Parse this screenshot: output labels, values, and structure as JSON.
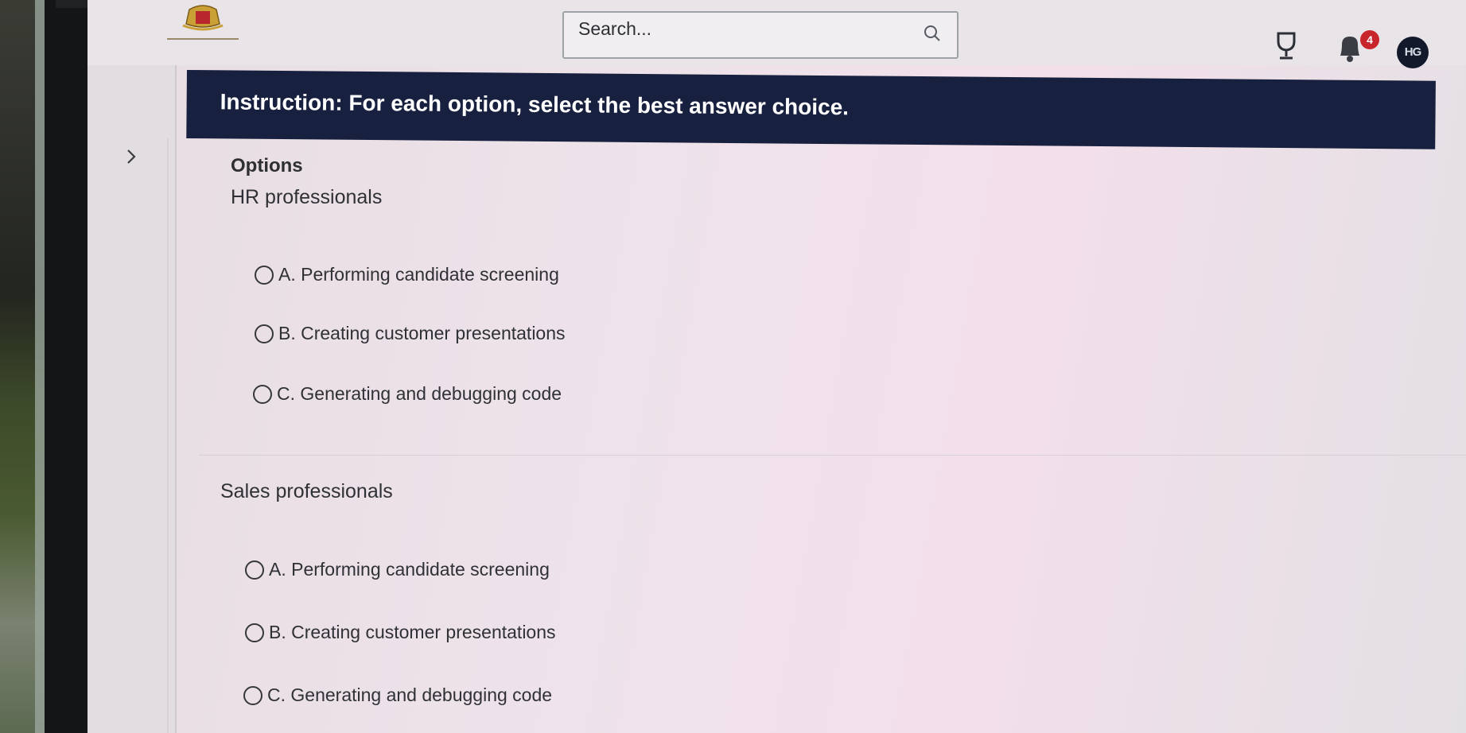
{
  "search": {
    "placeholder": "Search..."
  },
  "header": {
    "notifications_count": "4",
    "avatar_initials": "HG"
  },
  "instruction": "Instruction: For each option, select the best answer choice.",
  "options_title": "Options",
  "groups": [
    {
      "label": "HR professionals",
      "choices": [
        "A. Performing candidate screening",
        "B. Creating customer presentations",
        "C. Generating and debugging code"
      ]
    },
    {
      "label": "Sales professionals",
      "choices": [
        "A. Performing candidate screening",
        "B. Creating customer presentations",
        "C. Generating and debugging code"
      ]
    }
  ],
  "colors": {
    "banner": "#18203f",
    "badge": "#c8242c",
    "avatar": "#11192a"
  }
}
